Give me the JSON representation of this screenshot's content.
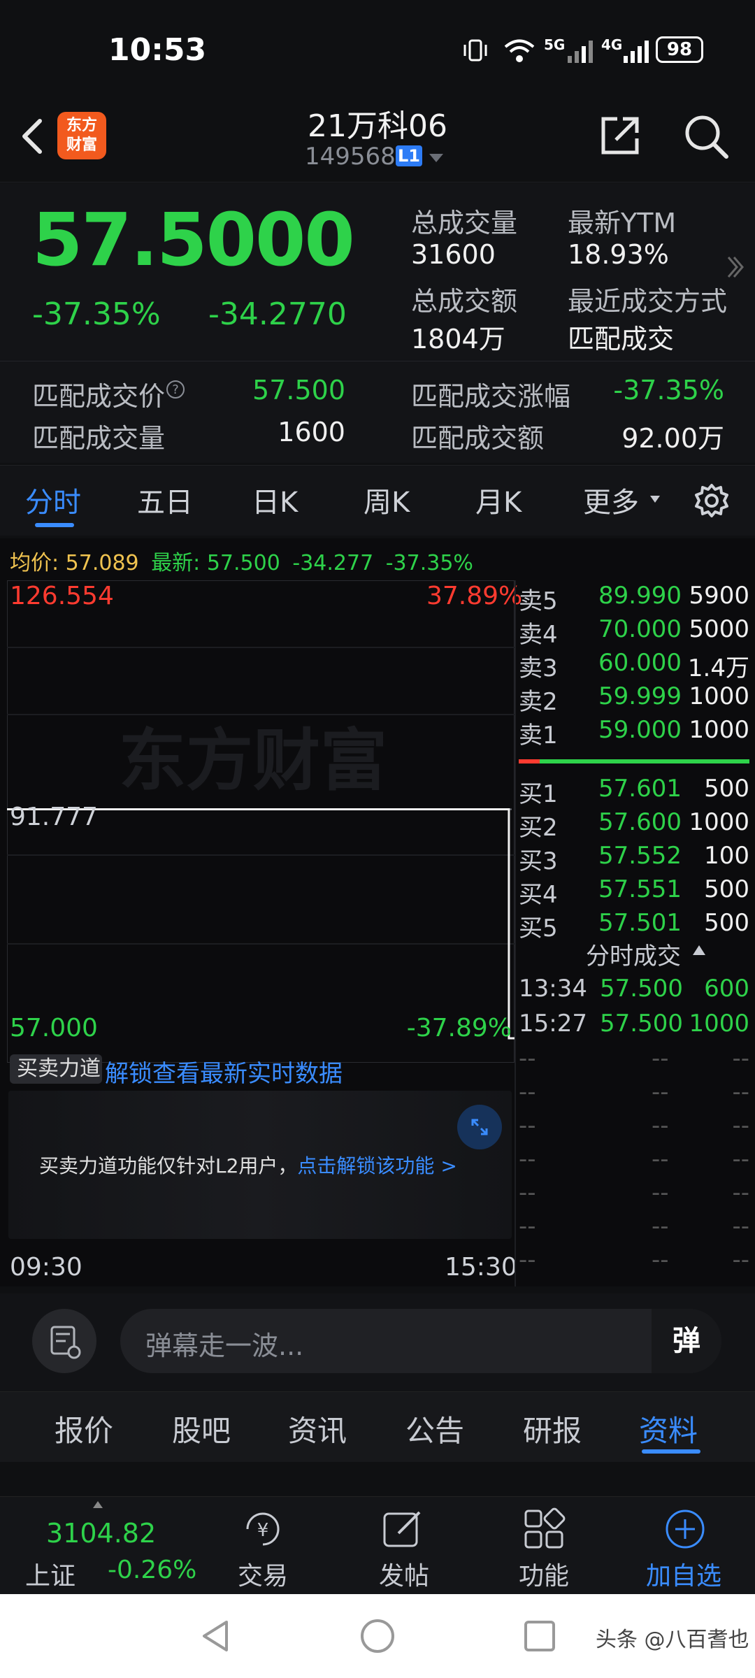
{
  "status": {
    "time": "10:53",
    "net1": "5G",
    "net2": "4G",
    "battery": "98"
  },
  "header": {
    "logo_text": "东方\n财富",
    "title": "21万科06",
    "code": "149568",
    "level": "L1"
  },
  "quote": {
    "price": "57.5000",
    "change_pct": "-37.35%",
    "change_amt": "-34.2770",
    "stats": [
      {
        "label": "总成交量",
        "value": "31600"
      },
      {
        "label": "最新YTM",
        "value": "18.93%"
      },
      {
        "label": "总成交额",
        "value": "1804万"
      },
      {
        "label": "最近成交方式",
        "value": "匹配成交"
      }
    ],
    "match": [
      {
        "label": "匹配成交价",
        "value": "57.500"
      },
      {
        "label": "匹配成交涨幅",
        "value": "-37.35%"
      },
      {
        "label": "匹配成交量",
        "value": "1600"
      },
      {
        "label": "匹配成交额",
        "value": "92.00万"
      }
    ]
  },
  "tabs": [
    "分时",
    "五日",
    "日K",
    "周K",
    "月K",
    "更多"
  ],
  "avgline": {
    "avg_label": "均价:",
    "avg": "57.089",
    "latest_label": "最新:",
    "latest": "57.500",
    "chg": "-34.277",
    "pct": "-37.35%"
  },
  "chart": {
    "y_top": "126.554",
    "y_mid": "91.777",
    "y_bot": "57.000",
    "pct_top": "37.89%",
    "pct_bot": "-37.89%",
    "x_start": "09:30",
    "x_end": "15:30",
    "watermark": "东方财富",
    "sub_tab": "买卖力道",
    "unlock_link": "解锁查看最新实时数据",
    "lock_msg": "买卖力道功能仅针对L2用户，",
    "lock_link": "点击解锁该功能 >"
  },
  "chart_data": {
    "type": "line",
    "x": [
      "09:30",
      "13:34",
      "15:27",
      "15:30"
    ],
    "values": [
      91.777,
      91.777,
      57.0,
      57.0
    ],
    "ylim": [
      57.0,
      126.554
    ]
  },
  "orderbook": {
    "asks": [
      {
        "label": "卖5",
        "price": "89.990",
        "vol": "5900"
      },
      {
        "label": "卖4",
        "price": "70.000",
        "vol": "5000"
      },
      {
        "label": "卖3",
        "price": "60.000",
        "vol": "1.4万"
      },
      {
        "label": "卖2",
        "price": "59.999",
        "vol": "1000"
      },
      {
        "label": "卖1",
        "price": "59.000",
        "vol": "1000"
      }
    ],
    "bids": [
      {
        "label": "买1",
        "price": "57.601",
        "vol": "500"
      },
      {
        "label": "买2",
        "price": "57.600",
        "vol": "1000"
      },
      {
        "label": "买3",
        "price": "57.552",
        "vol": "100"
      },
      {
        "label": "买4",
        "price": "57.551",
        "vol": "500"
      },
      {
        "label": "买5",
        "price": "57.501",
        "vol": "500"
      }
    ],
    "trades_title": "分时成交",
    "trades": [
      {
        "time": "13:34",
        "price": "57.500",
        "vol": "600"
      },
      {
        "time": "15:27",
        "price": "57.500",
        "vol": "1000"
      }
    ],
    "dash": "--"
  },
  "comment": {
    "placeholder": "弹幕走一波...",
    "send": "弹"
  },
  "bottom_tabs": [
    "报价",
    "股吧",
    "资讯",
    "公告",
    "研报",
    "资料"
  ],
  "footer": {
    "index_value": "3104.82",
    "index_name": "上证",
    "index_pct": "-0.26%",
    "trade": "交易",
    "post": "发帖",
    "func": "功能",
    "add": "加自选"
  },
  "watermark_bottom": "头条 @八百耆也"
}
